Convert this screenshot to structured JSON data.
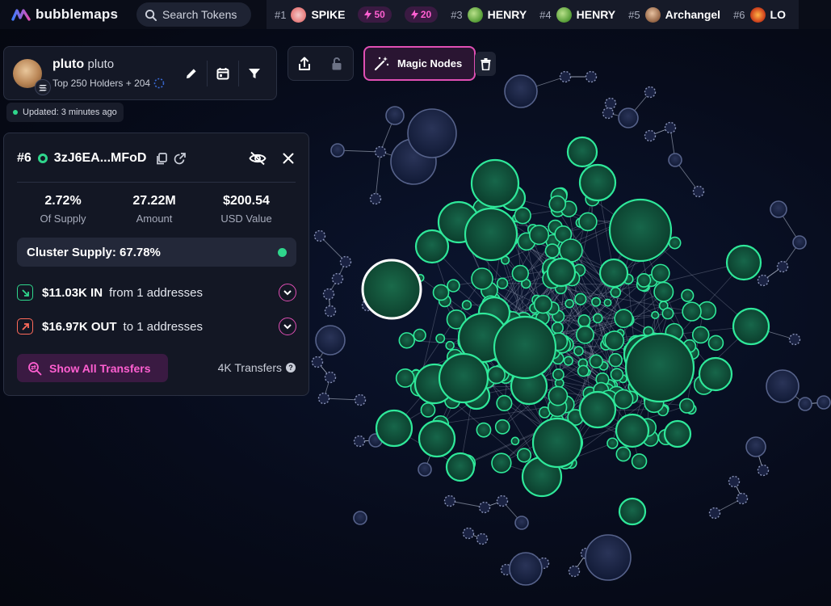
{
  "brand": {
    "name": "bubblemaps"
  },
  "search": {
    "placeholder": "Search Tokens"
  },
  "ticker": [
    {
      "rank": "#1",
      "name": "SPIKE",
      "boost": "50",
      "icon": "spike-token-icon"
    },
    {
      "rank": "",
      "name": "",
      "boost": "20",
      "icon": ""
    },
    {
      "rank": "#3",
      "name": "HENRY",
      "boost": "",
      "icon": "henry-token-icon"
    },
    {
      "rank": "#4",
      "name": "HENRY",
      "boost": "",
      "icon": "henry-token-icon"
    },
    {
      "rank": "#5",
      "name": "Archangel",
      "boost": "",
      "icon": "archangel-token-icon"
    },
    {
      "rank": "#6",
      "name": "LO",
      "boost": "",
      "icon": "lo-token-icon"
    }
  ],
  "token": {
    "symbol": "pluto",
    "name": "pluto",
    "subtitle": "Top 250 Holders + 204",
    "updated": "Updated: 3 minutes ago"
  },
  "toolbar": {
    "magic_nodes": "Magic Nodes"
  },
  "wallet": {
    "rank": "#6",
    "address": "3zJ6EA...MFoD",
    "stats": [
      {
        "value": "2.72%",
        "label": "Of Supply"
      },
      {
        "value": "27.22M",
        "label": "Amount"
      },
      {
        "value": "$200.54",
        "label": "USD Value"
      }
    ],
    "cluster_supply": "Cluster Supply: 67.78%",
    "inflow": {
      "amount": "$11.03K IN",
      "text": "from 1 addresses"
    },
    "outflow": {
      "amount": "$16.97K OUT",
      "text": "to 1 addresses"
    },
    "show_all": "Show All Transfers",
    "transfers": "4K Transfers"
  },
  "colors": {
    "accent_pink": "#e04fb4",
    "cluster_green": "#2fd68c",
    "node_blue": "#1b2547",
    "background": "#070c1c"
  }
}
